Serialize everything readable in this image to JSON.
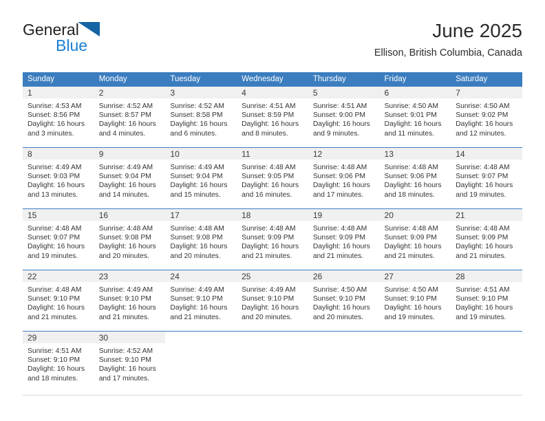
{
  "brand": {
    "name_part1": "General",
    "name_part2": "Blue",
    "logo_icon": "blue-triangle-mark",
    "color_dark": "#231f20",
    "color_blue": "#1b7fd4"
  },
  "header": {
    "title": "June 2025",
    "subtitle": "Ellison, British Columbia, Canada"
  },
  "theme": {
    "header_blue": "#3b7dbf",
    "daynum_band": "#f0f0f0",
    "text": "#333333"
  },
  "weekdays": [
    "Sunday",
    "Monday",
    "Tuesday",
    "Wednesday",
    "Thursday",
    "Friday",
    "Saturday"
  ],
  "labels": {
    "sunrise_prefix": "Sunrise:",
    "sunset_prefix": "Sunset:",
    "daylight_prefix": "Daylight:"
  },
  "weeks": [
    [
      {
        "day": "1",
        "sunrise": "Sunrise: 4:53 AM",
        "sunset": "Sunset: 8:56 PM",
        "daylight": "Daylight: 16 hours and 3 minutes."
      },
      {
        "day": "2",
        "sunrise": "Sunrise: 4:52 AM",
        "sunset": "Sunset: 8:57 PM",
        "daylight": "Daylight: 16 hours and 4 minutes."
      },
      {
        "day": "3",
        "sunrise": "Sunrise: 4:52 AM",
        "sunset": "Sunset: 8:58 PM",
        "daylight": "Daylight: 16 hours and 6 minutes."
      },
      {
        "day": "4",
        "sunrise": "Sunrise: 4:51 AM",
        "sunset": "Sunset: 8:59 PM",
        "daylight": "Daylight: 16 hours and 8 minutes."
      },
      {
        "day": "5",
        "sunrise": "Sunrise: 4:51 AM",
        "sunset": "Sunset: 9:00 PM",
        "daylight": "Daylight: 16 hours and 9 minutes."
      },
      {
        "day": "6",
        "sunrise": "Sunrise: 4:50 AM",
        "sunset": "Sunset: 9:01 PM",
        "daylight": "Daylight: 16 hours and 11 minutes."
      },
      {
        "day": "7",
        "sunrise": "Sunrise: 4:50 AM",
        "sunset": "Sunset: 9:02 PM",
        "daylight": "Daylight: 16 hours and 12 minutes."
      }
    ],
    [
      {
        "day": "8",
        "sunrise": "Sunrise: 4:49 AM",
        "sunset": "Sunset: 9:03 PM",
        "daylight": "Daylight: 16 hours and 13 minutes."
      },
      {
        "day": "9",
        "sunrise": "Sunrise: 4:49 AM",
        "sunset": "Sunset: 9:04 PM",
        "daylight": "Daylight: 16 hours and 14 minutes."
      },
      {
        "day": "10",
        "sunrise": "Sunrise: 4:49 AM",
        "sunset": "Sunset: 9:04 PM",
        "daylight": "Daylight: 16 hours and 15 minutes."
      },
      {
        "day": "11",
        "sunrise": "Sunrise: 4:48 AM",
        "sunset": "Sunset: 9:05 PM",
        "daylight": "Daylight: 16 hours and 16 minutes."
      },
      {
        "day": "12",
        "sunrise": "Sunrise: 4:48 AM",
        "sunset": "Sunset: 9:06 PM",
        "daylight": "Daylight: 16 hours and 17 minutes."
      },
      {
        "day": "13",
        "sunrise": "Sunrise: 4:48 AM",
        "sunset": "Sunset: 9:06 PM",
        "daylight": "Daylight: 16 hours and 18 minutes."
      },
      {
        "day": "14",
        "sunrise": "Sunrise: 4:48 AM",
        "sunset": "Sunset: 9:07 PM",
        "daylight": "Daylight: 16 hours and 19 minutes."
      }
    ],
    [
      {
        "day": "15",
        "sunrise": "Sunrise: 4:48 AM",
        "sunset": "Sunset: 9:07 PM",
        "daylight": "Daylight: 16 hours and 19 minutes."
      },
      {
        "day": "16",
        "sunrise": "Sunrise: 4:48 AM",
        "sunset": "Sunset: 9:08 PM",
        "daylight": "Daylight: 16 hours and 20 minutes."
      },
      {
        "day": "17",
        "sunrise": "Sunrise: 4:48 AM",
        "sunset": "Sunset: 9:08 PM",
        "daylight": "Daylight: 16 hours and 20 minutes."
      },
      {
        "day": "18",
        "sunrise": "Sunrise: 4:48 AM",
        "sunset": "Sunset: 9:09 PM",
        "daylight": "Daylight: 16 hours and 21 minutes."
      },
      {
        "day": "19",
        "sunrise": "Sunrise: 4:48 AM",
        "sunset": "Sunset: 9:09 PM",
        "daylight": "Daylight: 16 hours and 21 minutes."
      },
      {
        "day": "20",
        "sunrise": "Sunrise: 4:48 AM",
        "sunset": "Sunset: 9:09 PM",
        "daylight": "Daylight: 16 hours and 21 minutes."
      },
      {
        "day": "21",
        "sunrise": "Sunrise: 4:48 AM",
        "sunset": "Sunset: 9:09 PM",
        "daylight": "Daylight: 16 hours and 21 minutes."
      }
    ],
    [
      {
        "day": "22",
        "sunrise": "Sunrise: 4:48 AM",
        "sunset": "Sunset: 9:10 PM",
        "daylight": "Daylight: 16 hours and 21 minutes."
      },
      {
        "day": "23",
        "sunrise": "Sunrise: 4:49 AM",
        "sunset": "Sunset: 9:10 PM",
        "daylight": "Daylight: 16 hours and 21 minutes."
      },
      {
        "day": "24",
        "sunrise": "Sunrise: 4:49 AM",
        "sunset": "Sunset: 9:10 PM",
        "daylight": "Daylight: 16 hours and 21 minutes."
      },
      {
        "day": "25",
        "sunrise": "Sunrise: 4:49 AM",
        "sunset": "Sunset: 9:10 PM",
        "daylight": "Daylight: 16 hours and 20 minutes."
      },
      {
        "day": "26",
        "sunrise": "Sunrise: 4:50 AM",
        "sunset": "Sunset: 9:10 PM",
        "daylight": "Daylight: 16 hours and 20 minutes."
      },
      {
        "day": "27",
        "sunrise": "Sunrise: 4:50 AM",
        "sunset": "Sunset: 9:10 PM",
        "daylight": "Daylight: 16 hours and 19 minutes."
      },
      {
        "day": "28",
        "sunrise": "Sunrise: 4:51 AM",
        "sunset": "Sunset: 9:10 PM",
        "daylight": "Daylight: 16 hours and 19 minutes."
      }
    ],
    [
      {
        "day": "29",
        "sunrise": "Sunrise: 4:51 AM",
        "sunset": "Sunset: 9:10 PM",
        "daylight": "Daylight: 16 hours and 18 minutes."
      },
      {
        "day": "30",
        "sunrise": "Sunrise: 4:52 AM",
        "sunset": "Sunset: 9:10 PM",
        "daylight": "Daylight: 16 hours and 17 minutes."
      },
      {
        "day": "",
        "sunrise": "",
        "sunset": "",
        "daylight": ""
      },
      {
        "day": "",
        "sunrise": "",
        "sunset": "",
        "daylight": ""
      },
      {
        "day": "",
        "sunrise": "",
        "sunset": "",
        "daylight": ""
      },
      {
        "day": "",
        "sunrise": "",
        "sunset": "",
        "daylight": ""
      },
      {
        "day": "",
        "sunrise": "",
        "sunset": "",
        "daylight": ""
      }
    ]
  ]
}
